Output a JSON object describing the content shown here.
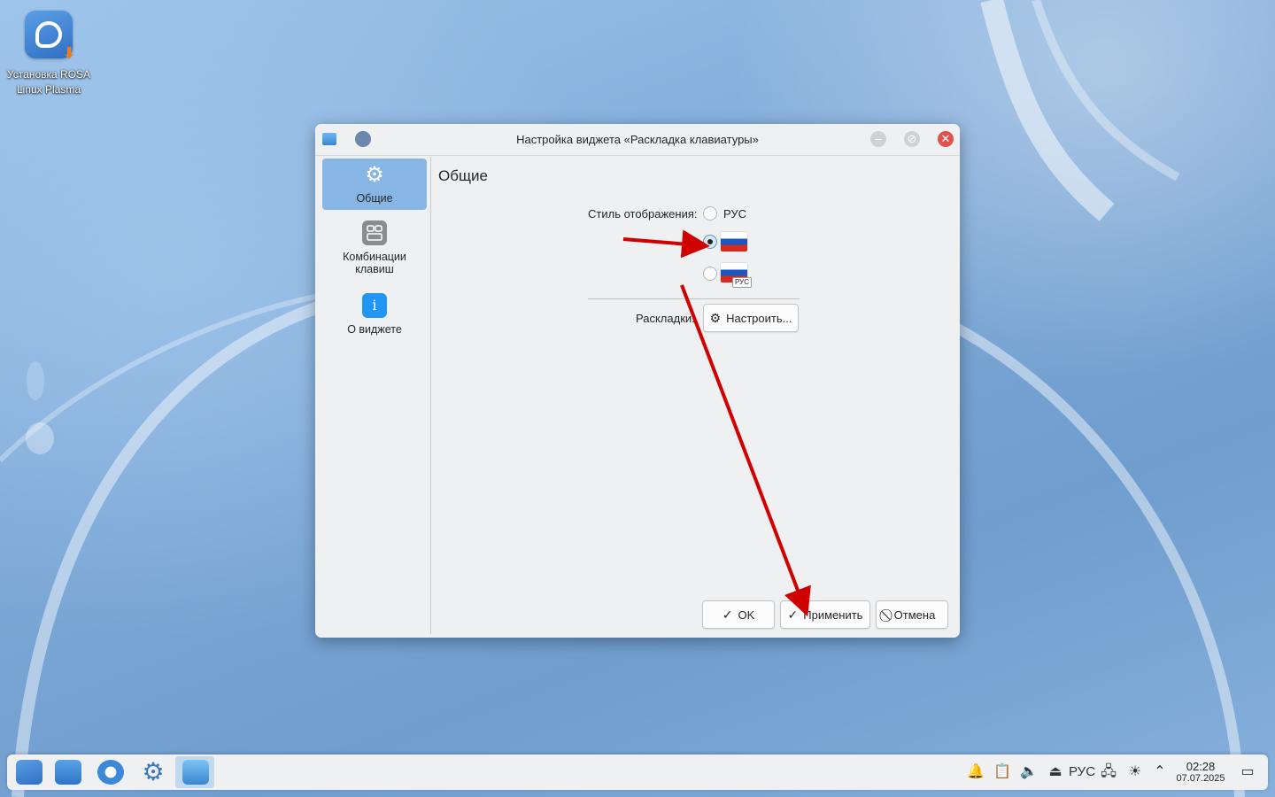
{
  "desktop": {
    "icon_label_line1": "Установка ROSA",
    "icon_label_line2": "Linux Plasma",
    "icon_name": "rosa-installer-icon"
  },
  "dialog": {
    "title": "Настройка виджета «Раскладка клавиатуры»",
    "sidebar": [
      {
        "label": "Общие",
        "icon": "gear-icon",
        "active": true
      },
      {
        "label_line1": "Комбинации",
        "label_line2": "клавиш",
        "icon": "shortcuts-icon"
      },
      {
        "label": "О виджете",
        "icon": "info-icon",
        "icon_glyph": "i"
      }
    ],
    "page_title": "Общие",
    "display_style": {
      "label": "Стиль отображения:",
      "options": [
        {
          "label": "РУС",
          "checked": false
        },
        {
          "label": "",
          "icon": "russia-flag-icon",
          "checked": true
        },
        {
          "label": "",
          "icon": "russia-flag-label-icon",
          "badge": "РУС",
          "checked": false
        }
      ]
    },
    "layouts": {
      "label": "Раскладки:",
      "button": "Настроить..."
    },
    "buttons": {
      "ok": "OK",
      "apply": "Применить",
      "cancel": "Отмена"
    },
    "accent_color": "#88b6e4"
  },
  "annotations": {
    "arrow_color": "#d10000"
  },
  "taskbar": {
    "apps": [
      "rosa-launcher-icon",
      "file-manager-icon",
      "browser-icon",
      "settings-icon",
      "image-viewer-icon"
    ],
    "tray_language": "РУС",
    "time": "02:28",
    "date": "07.07.2025"
  }
}
